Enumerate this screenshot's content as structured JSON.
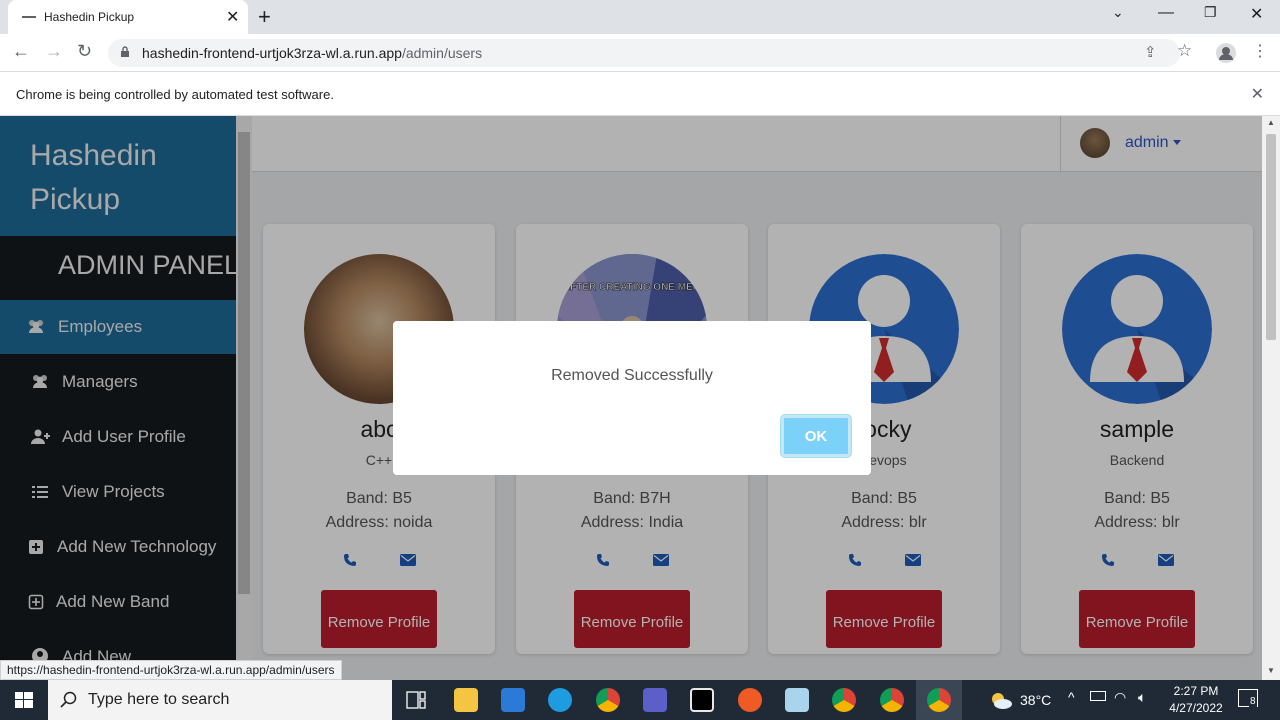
{
  "browser": {
    "tab_title": "Hashedin Pickup",
    "url_host": "hashedin-frontend-urtjok3rza-wl.a.run.app",
    "url_path": "/admin/users",
    "infobar_message": "Chrome is being controlled by automated test software.",
    "status_url": "https://hashedin-frontend-urtjok3rza-wl.a.run.app/admin/users"
  },
  "sidebar": {
    "brand": "Hashedin Pickup",
    "panel_title": "ADMIN PANEL",
    "items": [
      {
        "label": "Employees",
        "icon": "users-icon"
      },
      {
        "label": "Managers",
        "icon": "users-icon"
      },
      {
        "label": "Add User Profile",
        "icon": "user-plus-icon"
      },
      {
        "label": "View Projects",
        "icon": "list-icon"
      },
      {
        "label": "Add New Technology",
        "icon": "plus-square-icon"
      },
      {
        "label": "Add New Band",
        "icon": "plus-square-outline-icon"
      },
      {
        "label": "Add New",
        "icon": "user-circle-icon"
      }
    ]
  },
  "topnav": {
    "user": "admin"
  },
  "cards": [
    {
      "name": "abc",
      "tech": "C++",
      "band": "Band: B5",
      "address": "Address: noida",
      "remove": "Remove Profile"
    },
    {
      "name": "",
      "tech": "",
      "band": "Band: B7H",
      "address": "Address: India",
      "remove": "Remove Profile",
      "pic_caption": "AFTER CREATING ONE MEM"
    },
    {
      "name": "rocky",
      "tech": "devops",
      "band": "Band: B5",
      "address": "Address: blr",
      "remove": "Remove Profile"
    },
    {
      "name": "sample",
      "tech": "Backend",
      "band": "Band: B5",
      "address": "Address: blr",
      "remove": "Remove Profile"
    }
  ],
  "modal": {
    "message": "Removed Successfully",
    "ok_label": "OK"
  },
  "taskbar": {
    "search_placeholder": "Type here to search",
    "temperature": "38°C",
    "time": "2:27 PM",
    "date": "4/27/2022",
    "notification_count": "8"
  },
  "colors": {
    "brand_blue": "#1e6c9a",
    "sidebar_bg": "#161a1d",
    "remove_red": "#b91e2c",
    "ok_blue": "#7cd1f9"
  }
}
